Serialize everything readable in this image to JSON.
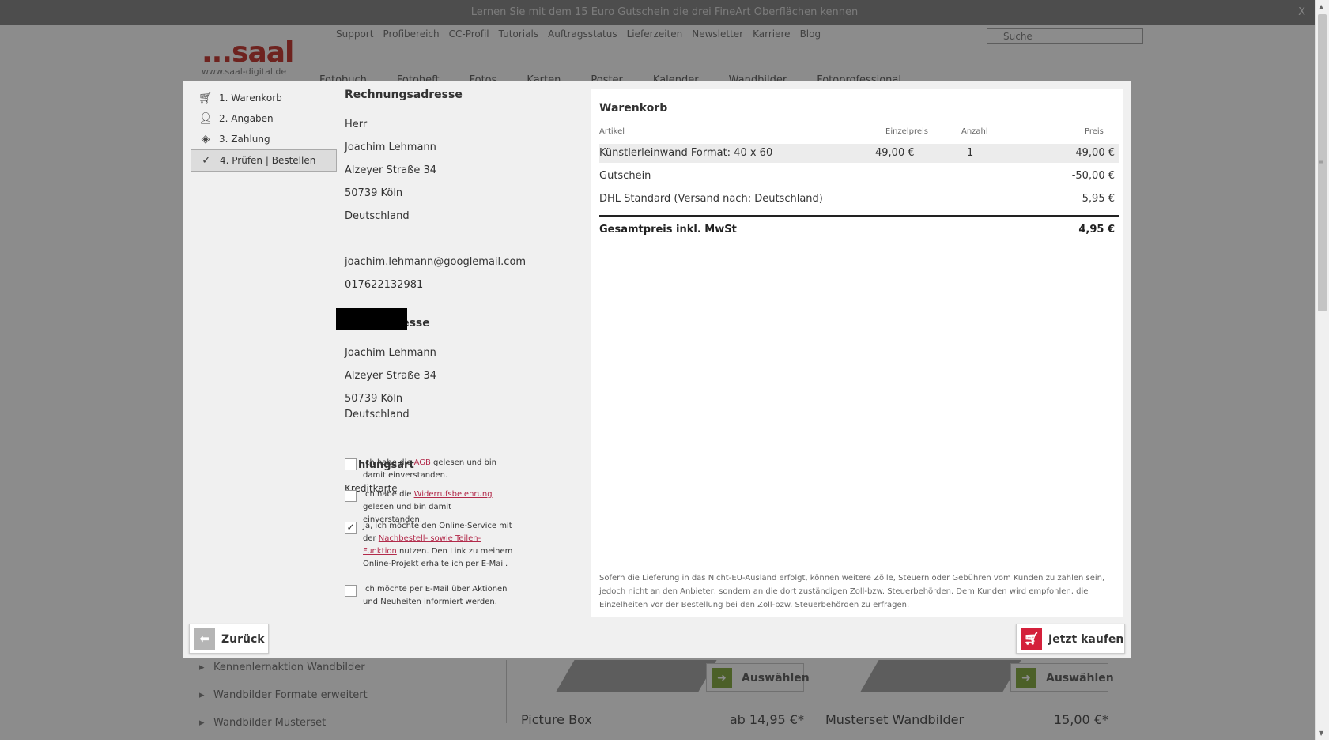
{
  "background": {
    "banner": "Lernen Sie mit dem 15 Euro Gutschein die drei FineArt Oberflächen kennen",
    "banner_close": "X",
    "util_nav": [
      "Support",
      "Profibereich",
      "CC-Profil",
      "Tutorials",
      "Auftragsstatus",
      "Lieferzeiten",
      "Newsletter",
      "Karriere",
      "Blog"
    ],
    "search_placeholder": "Suche",
    "logo": "...saal",
    "logo_url": "www.saal-digital.de",
    "main_nav": [
      "Fotobuch",
      "Fotoheft",
      "Fotos",
      "Karten",
      "Poster",
      "Kalender",
      "Wandbilder",
      "Fotoprofessional"
    ],
    "sidebar": [
      "Kennenlernaktion Wandbilder",
      "Wandbilder Formate erweitert",
      "Wandbilder Musterset"
    ],
    "products": [
      {
        "name": "Picture Box",
        "price": "ab 14,95 €*",
        "select": "Auswählen"
      },
      {
        "name": "Musterset Wandbilder",
        "price": "15,00 €*",
        "select": "Auswählen"
      }
    ]
  },
  "steps": [
    {
      "label": "1. Warenkorb",
      "icon": "cart-icon"
    },
    {
      "label": "2. Angaben",
      "icon": "person-icon"
    },
    {
      "label": "3. Zahlung",
      "icon": "tag-icon"
    },
    {
      "label": "4. Prüfen | Bestellen",
      "icon": "check-icon",
      "active": true
    }
  ],
  "billing": {
    "title": "Rechnungsadresse",
    "salutation": "Herr",
    "name": "Joachim Lehmann",
    "street": "Alzeyer Straße 34",
    "city": "50739 Köln",
    "country": "Deutschland",
    "email": "joachim.lehmann@googlemail.com",
    "phone": "017622132981"
  },
  "shipping": {
    "title": "Lieferadresse",
    "name": "Joachim Lehmann",
    "street": "Alzeyer Straße 34",
    "city": "50739 Köln",
    "country": "Deutschland"
  },
  "payment": {
    "title_partial": "hlungsart",
    "method": "Kreditkarte"
  },
  "checkboxes": [
    {
      "pre": "Ich habe die ",
      "link": "AGB",
      "post": " gelesen und bin damit einverstanden.",
      "checked": false
    },
    {
      "pre": "Ich habe die ",
      "link": "Widerrufsbelehrung",
      "post": " gelesen und bin damit einverstanden.",
      "checked": false
    },
    {
      "pre": "Ja, ich möchte den Online-Service mit der ",
      "link": "Nachbestell- sowie Teilen-Funktion",
      "post": " nutzen. Den Link zu meinem Online-Projekt erhalte ich per E-Mail.",
      "checked": true
    },
    {
      "pre": "Ich möchte per E-Mail über Aktionen und Neuheiten informiert werden.",
      "link": "",
      "post": "",
      "checked": false
    }
  ],
  "cart": {
    "title": "Warenkorb",
    "headers": {
      "article": "Artikel",
      "unit_price": "Einzelpreis",
      "qty": "Anzahl",
      "price": "Preis"
    },
    "rows": [
      {
        "article": "Künstlerleinwand Format: 40 x 60",
        "unit_price": "49,00 €",
        "qty": "1",
        "price": "49,00 €"
      },
      {
        "article": "Gutschein",
        "unit_price": "",
        "qty": "",
        "price": "-50,00 €"
      },
      {
        "article": "DHL Standard (Versand nach: Deutschland)",
        "unit_price": "",
        "qty": "",
        "price": "5,95 €"
      }
    ],
    "total_label": "Gesamtpreis inkl. MwSt",
    "total_value": "4,95 €",
    "note": "Sofern die Lieferung in das Nicht-EU-Ausland erfolgt, können weitere Zölle, Steuern oder Gebühren vom Kunden zu zahlen sein, jedoch nicht an den Anbieter, sondern an die dort zuständigen Zoll-bzw. Steuerbehörden. Dem Kunden wird empfohlen, die Einzelheiten vor der Bestellung bei den Zoll-bzw. Steuerbehörden zu erfragen."
  },
  "buttons": {
    "back": "Zurück",
    "buy": "Jetzt kaufen"
  },
  "colors": {
    "accent": "#d4203b",
    "link": "#b22a4a",
    "overlay": "rgba(0,0,0,0.45)"
  }
}
